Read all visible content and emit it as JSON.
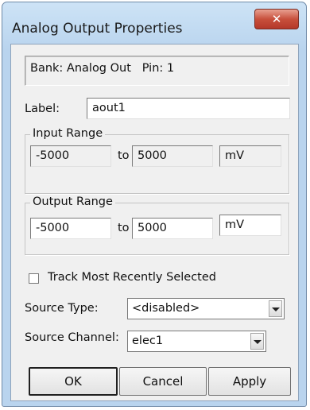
{
  "window": {
    "title": "Analog Output Properties",
    "close_glyph": "✕"
  },
  "bank_info": "Bank: Analog Out   Pin: 1",
  "label": {
    "caption": "Label:",
    "value": "aout1"
  },
  "input_range": {
    "title": "Input Range",
    "min": "-5000",
    "to": "to",
    "max": "5000",
    "unit": "mV"
  },
  "output_range": {
    "title": "Output Range",
    "min": "-5000",
    "to": "to",
    "max": "5000",
    "unit": "mV"
  },
  "track_checkbox": {
    "label": "Track Most Recently Selected",
    "checked": false
  },
  "source_type": {
    "label": "Source Type:",
    "value": "<disabled>"
  },
  "source_channel": {
    "label": "Source Channel:",
    "value": "elec1"
  },
  "buttons": {
    "ok": "OK",
    "cancel": "Cancel",
    "apply": "Apply"
  },
  "icons": {
    "close": "close-icon",
    "dropdown": "chevron-down-icon"
  }
}
